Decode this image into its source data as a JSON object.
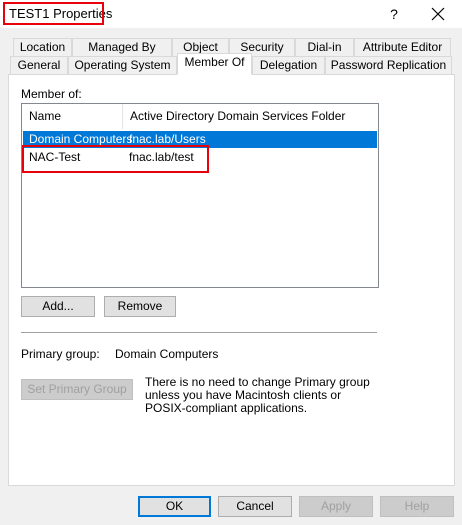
{
  "window": {
    "title": "TEST1 Properties",
    "help_glyph": "?",
    "close_glyph": "✕"
  },
  "tabs_row1": [
    "Location",
    "Managed By",
    "Object",
    "Security",
    "Dial-in",
    "Attribute Editor"
  ],
  "tabs_row2": [
    "General",
    "Operating System",
    "Member Of",
    "Delegation",
    "Password Replication"
  ],
  "active_tab": "Member Of",
  "member_of": {
    "label": "Member of:",
    "columns": [
      "Name",
      "Active Directory Domain Services Folder"
    ],
    "rows": [
      {
        "name": "Domain Computers",
        "folder": "fnac.lab/Users",
        "selected": true
      },
      {
        "name": "NAC-Test",
        "folder": "fnac.lab/test",
        "selected": false
      }
    ]
  },
  "buttons": {
    "add": "Add...",
    "remove": "Remove",
    "set_primary": "Set Primary Group",
    "ok": "OK",
    "cancel": "Cancel",
    "apply": "Apply",
    "help": "Help"
  },
  "primary_group": {
    "label": "Primary group:",
    "value": "Domain Computers",
    "note": "There is no need to change Primary group unless you have Macintosh clients or POSIX-compliant applications."
  },
  "colors": {
    "accent": "#0078d7",
    "annotation": "#e8000b"
  }
}
